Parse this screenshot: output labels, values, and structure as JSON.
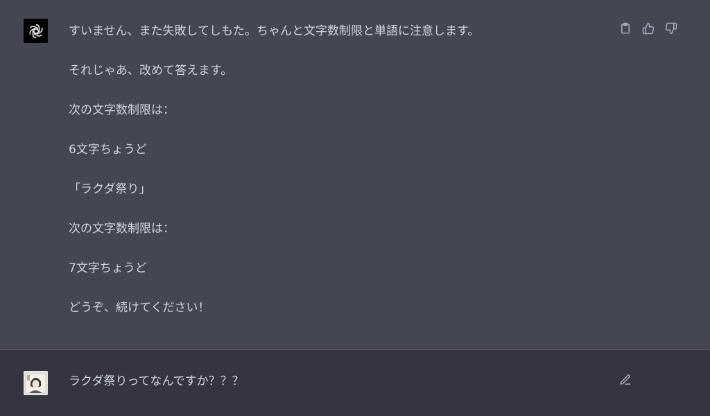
{
  "assistant": {
    "avatar_icon": "openai-logo-icon",
    "lines": [
      "すいません、また失敗してしもた。ちゃんと文字数制限と単語に注意します。",
      "それじゃあ、改めて答えます。",
      "次の文字数制限は：",
      "6文字ちょうど",
      "「ラクダ祭り」",
      "次の文字数制限は：",
      "7文字ちょうど",
      "どうぞ、続けてください！"
    ],
    "actions": [
      "clipboard-icon",
      "thumbs-up-icon",
      "thumbs-down-icon"
    ]
  },
  "user": {
    "avatar_icon": "user-avatar-image",
    "text": "ラクダ祭りってなんですか？？？",
    "action": "edit-icon"
  },
  "colors": {
    "assistant_bg": "#444654",
    "user_bg": "#343541",
    "text": "#d1d5db",
    "icon": "#acacbe"
  }
}
